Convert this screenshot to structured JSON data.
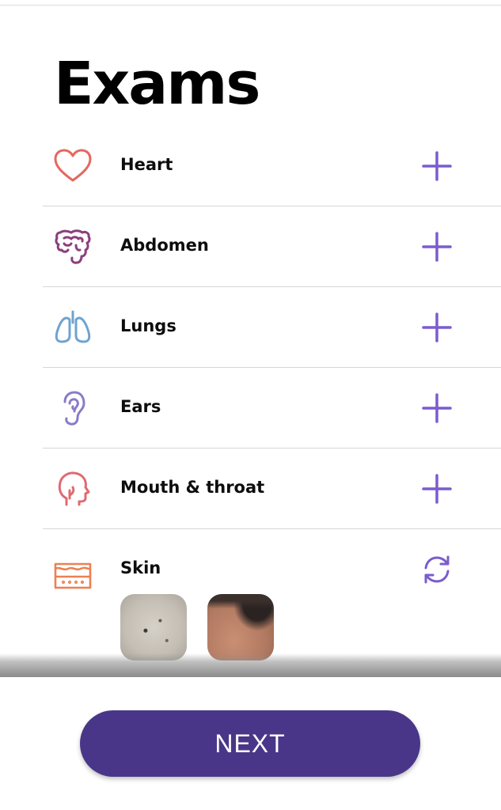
{
  "page": {
    "title": "Exams"
  },
  "exams": [
    {
      "label": "Heart",
      "icon": "heart-icon",
      "icon_color": "#e5675f",
      "action": "add"
    },
    {
      "label": "Abdomen",
      "icon": "intestines-icon",
      "icon_color": "#8b3f7c",
      "action": "add"
    },
    {
      "label": "Lungs",
      "icon": "lungs-icon",
      "icon_color": "#6fa3cf",
      "action": "add"
    },
    {
      "label": "Ears",
      "icon": "ear-icon",
      "icon_color": "#8a7bc6",
      "action": "add"
    },
    {
      "label": "Mouth & throat",
      "icon": "head-profile-icon",
      "icon_color": "#e06a72",
      "action": "add"
    },
    {
      "label": "Skin",
      "icon": "skin-layer-icon",
      "icon_color": "#ec8052",
      "action": "retake",
      "photos": [
        "skin-photo-thumbnail",
        "forehead-photo-thumbnail"
      ]
    }
  ],
  "actions": {
    "add_icon": "plus-icon",
    "retake_icon": "refresh-icon",
    "accent_color": "#7a5ccf"
  },
  "footer": {
    "next_label": "NEXT",
    "button_color": "#4a3688"
  }
}
